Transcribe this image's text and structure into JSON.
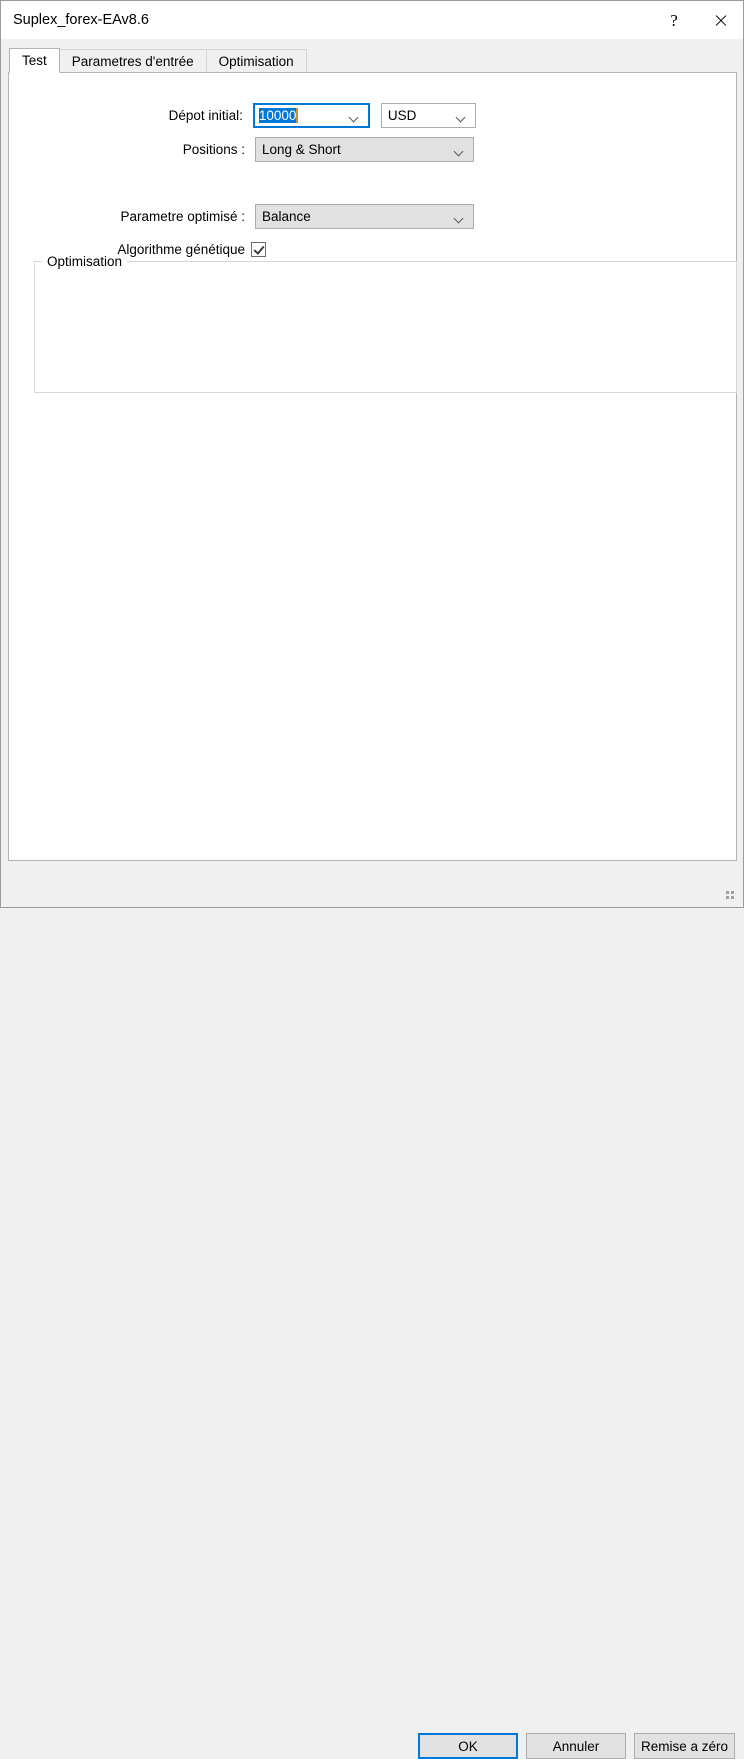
{
  "window": {
    "title": "Suplex_forex-EAv8.6",
    "help_button": "?",
    "close_button": "✕"
  },
  "tabs": [
    {
      "label": "Test",
      "selected": true
    },
    {
      "label": "Parametres d'entrée",
      "selected": false
    },
    {
      "label": "Optimisation",
      "selected": false
    }
  ],
  "form": {
    "deposit": {
      "label": "Dépot initial:",
      "value": "10000",
      "currency": "USD"
    },
    "positions": {
      "label": "Positions :",
      "value": "Long & Short"
    }
  },
  "optimisation_group": {
    "title": "Optimisation",
    "parameter": {
      "label": "Parametre optimisé :",
      "value": "Balance"
    },
    "genetic": {
      "label": "Algorithme génétique",
      "checked": true
    }
  },
  "footer": {
    "ok": "OK",
    "cancel": "Annuler",
    "reset": "Remise a zéro"
  },
  "colors": {
    "accent": "#0078d7",
    "selection": "#0078d7",
    "caret": "#d58a3a",
    "control_face": "#e1e1e1",
    "dialog_bg": "#f0f0f0",
    "panel_bg": "#ffffff",
    "border": "#acacac"
  }
}
